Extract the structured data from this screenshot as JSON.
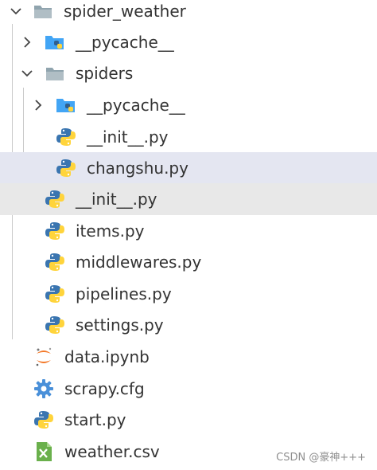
{
  "explorer": {
    "items": [
      {
        "label": "spider_weather",
        "icon": "folder-open-icon"
      },
      {
        "label": "__pycache__",
        "icon": "pycache-folder-icon"
      },
      {
        "label": "spiders",
        "icon": "folder-open-icon"
      },
      {
        "label": "__pycache__",
        "icon": "pycache-folder-icon"
      },
      {
        "label": "__init__.py",
        "icon": "python-file-icon"
      },
      {
        "label": "changshu.py",
        "icon": "python-file-icon"
      },
      {
        "label": "__init__.py",
        "icon": "python-file-icon"
      },
      {
        "label": "items.py",
        "icon": "python-file-icon"
      },
      {
        "label": "middlewares.py",
        "icon": "python-file-icon"
      },
      {
        "label": "pipelines.py",
        "icon": "python-file-icon"
      },
      {
        "label": "settings.py",
        "icon": "python-file-icon"
      },
      {
        "label": "data.ipynb",
        "icon": "jupyter-icon"
      },
      {
        "label": "scrapy.cfg",
        "icon": "gear-icon"
      },
      {
        "label": "start.py",
        "icon": "python-file-icon"
      },
      {
        "label": "weather.csv",
        "icon": "excel-file-icon"
      }
    ]
  },
  "watermark": "CSDN @豪神+++",
  "colors": {
    "selected_row": "#e4e6f1",
    "hovered_row": "#e8e8e8",
    "python_blue": "#3a75b0",
    "python_yellow": "#ffd43b",
    "folder_gray": "#90a4ae",
    "pycache_folder": "#42a5f5",
    "gear": "#4a90d9",
    "excel_green": "#6ab04c",
    "jupyter_orange": "#f37726"
  }
}
